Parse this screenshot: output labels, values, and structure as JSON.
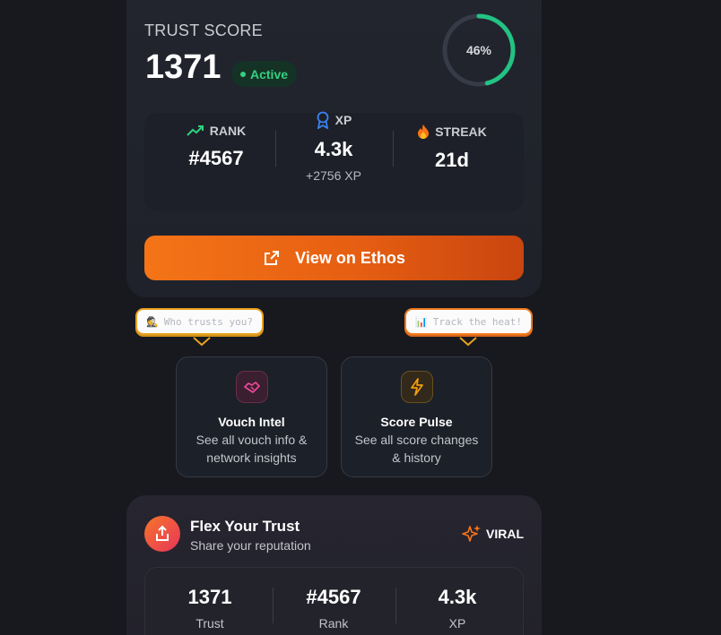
{
  "score_card": {
    "label": "TRUST SCORE",
    "score": "1371",
    "status": "Active",
    "progress_text": "46%",
    "progress_fraction": 0.46,
    "stats": {
      "rank_label": "RANK",
      "rank_value": "#4567",
      "xp_label": "XP",
      "xp_value": "4.3k",
      "xp_sub": "+2756 XP",
      "streak_label": "STREAK",
      "streak_value": "21d"
    },
    "button_label": "View on Ethos"
  },
  "tooltips": {
    "left": "Who trusts you?",
    "left_emoji": "🕵",
    "right": "Track the heat!",
    "right_emoji": "📊"
  },
  "features": [
    {
      "title": "Vouch Intel",
      "desc": "See all vouch info & network insights",
      "icon": "handshake-icon"
    },
    {
      "title": "Score Pulse",
      "desc": "See all score changes & history",
      "icon": "lightning-icon"
    }
  ],
  "flex_card": {
    "title": "Flex Your Trust",
    "subtitle": "Share your reputation",
    "badge": "VIRAL",
    "stats": [
      {
        "value": "1371",
        "label": "Trust"
      },
      {
        "value": "#4567",
        "label": "Rank"
      },
      {
        "value": "4.3k",
        "label": "XP"
      }
    ]
  },
  "colors": {
    "accent_orange": "#f47417",
    "active_green": "#35d07f",
    "ring_green": "#22c383",
    "background": "#17191f"
  }
}
